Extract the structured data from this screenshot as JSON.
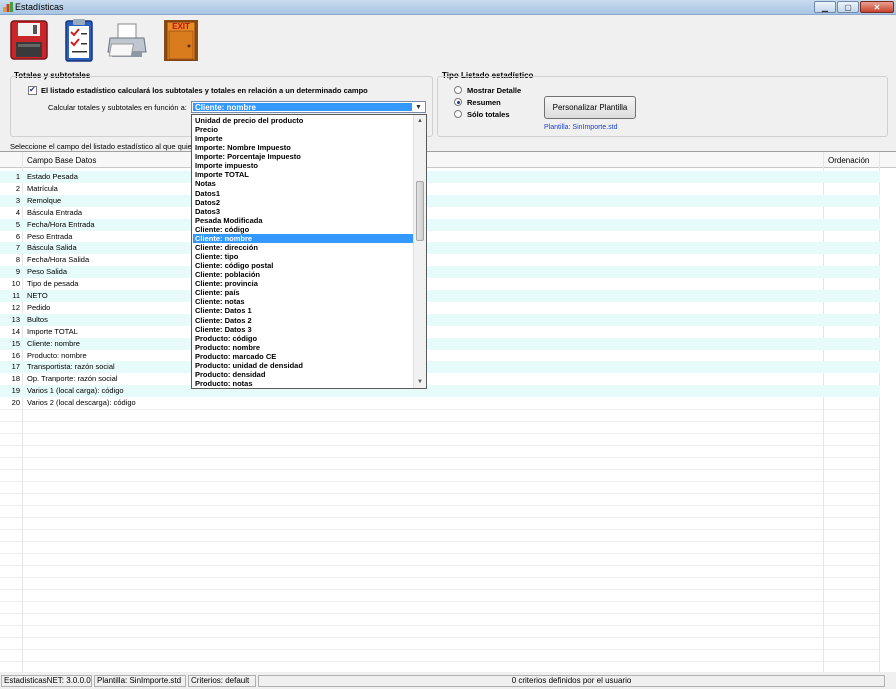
{
  "window": {
    "title": "Estadísticas"
  },
  "toolbar": {
    "save_icon": "floppy-disk-icon",
    "report_icon": "checklist-icon",
    "print_icon": "printer-icon",
    "exit_icon": "exit-door-icon",
    "exit_label": "EXIT"
  },
  "totales": {
    "group_label": "Totales y subtotales",
    "checkbox_label": "El listado estadístico calculará los subtotales y totales en relación a un determinado campo",
    "checked": true,
    "calc_label": "Calcular totales y subtotales en función a:",
    "combo_value": "Cliente: nombre"
  },
  "tipo": {
    "group_label": "Tipo Listado estadístico",
    "options": [
      "Mostrar Detalle",
      "Resumen",
      "Sólo totales"
    ],
    "selected": "Resumen",
    "button_label": "Personalizar Plantilla",
    "plantilla_link": "Plantilla: SinImporte.std"
  },
  "instruction": "Seleccione el campo del listado estadístico al que quie",
  "grid": {
    "col_campo": "Campo Base Datos",
    "col_ordenacion": "Ordenación",
    "rows": [
      "Estado Pesada",
      "Matrícula",
      "Remolque",
      "Báscula Entrada",
      "Fecha/Hora Entrada",
      "Peso Entrada",
      "Báscula Salida",
      "Fecha/Hora Salida",
      "Peso Salida",
      "Tipo de pesada",
      "NETO",
      "Pedido",
      "Bultos",
      "Importe TOTAL",
      "Cliente: nombre",
      "Producto: nombre",
      "Transportista: razón social",
      "Op. Tranporte: razón social",
      "Varios 1 (local carga): código",
      "Varios 2 (local descarga): código"
    ]
  },
  "dropdown": {
    "items": [
      "Unidad de precio del producto",
      "Precio",
      "Importe",
      "Importe: Nombre Impuesto",
      "Importe: Porcentaje Impuesto",
      "Importe impuesto",
      "Importe TOTAL",
      "Notas",
      "Datos1",
      "Datos2",
      "Datos3",
      "Pesada Modificada",
      "Cliente: código",
      "Cliente: nombre",
      "Cliente: dirección",
      "Cliente: tipo",
      "Cliente: código postal",
      "Cliente: población",
      "Cliente: provincia",
      "Cliente: país",
      "Cliente: notas",
      "Cliente: Datos 1",
      "Cliente: Datos 2",
      "Cliente: Datos 3",
      "Producto: código",
      "Producto: nombre",
      "Producto: marcado CE",
      "Producto: unidad de densidad",
      "Producto: densidad",
      "Producto: notas"
    ],
    "selected_index": 13
  },
  "status": {
    "version": "EstadisticasNET: 3.0.0.0",
    "plantilla": "Plantilla: SinImporte.std",
    "criterios": "Criterios: default",
    "criterios_usuario": "0 criterios definidos por el usuario"
  }
}
